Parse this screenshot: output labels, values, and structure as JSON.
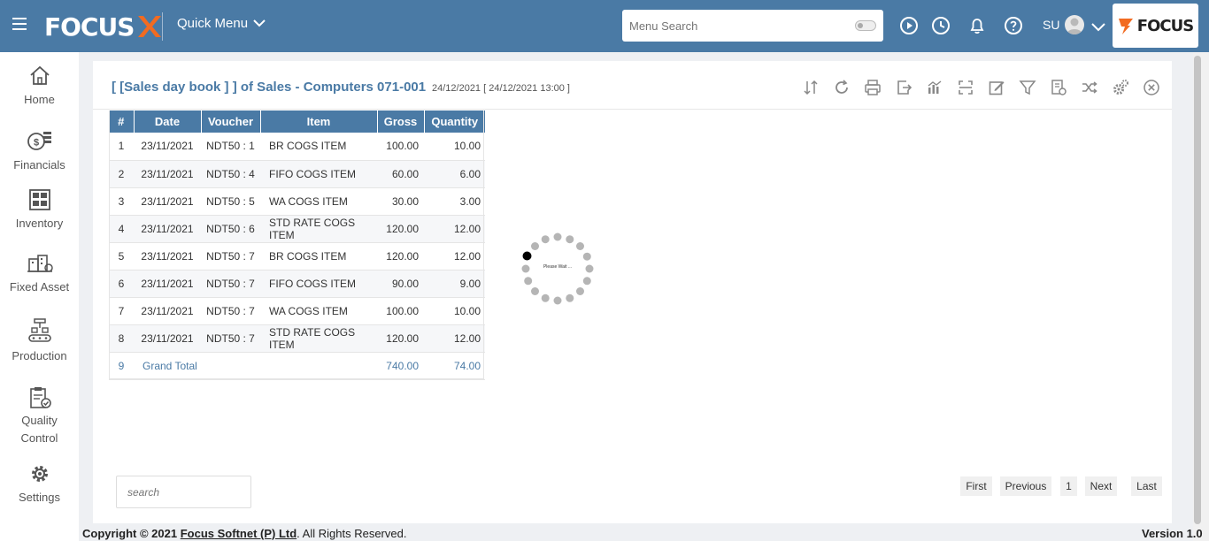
{
  "header": {
    "logo_text": "FOCUS",
    "quick_menu_label": "Quick Menu",
    "search_placeholder": "Menu Search",
    "user_initials": "SU",
    "brand_text": "FOCUS",
    "colors": {
      "bar": "#4a7aa5",
      "logo_x_orange": "#f26b21"
    }
  },
  "sidebar": {
    "items": [
      {
        "label": "Home",
        "icon": "home-icon"
      },
      {
        "label": "Financials",
        "icon": "coins-icon"
      },
      {
        "label": "Inventory",
        "icon": "warehouse-icon"
      },
      {
        "label": "Fixed Asset",
        "icon": "building-icon"
      },
      {
        "label": "Production",
        "icon": "conveyor-icon"
      },
      {
        "label": "Quality",
        "label2": "Control",
        "icon": "clipboard-check-icon"
      },
      {
        "label": "Settings",
        "icon": "gear-icon"
      }
    ]
  },
  "report": {
    "title": "[ [Sales day book ] ] of Sales - Computers 071-001",
    "subtitle": "24/12/2021 [ 24/12/2021 13:00 ]",
    "toolbar_icons": [
      "sort-icon",
      "refresh-icon",
      "print-icon",
      "export-icon",
      "chart-icon",
      "expand-icon",
      "edit-icon",
      "filter-icon",
      "report-settings-icon",
      "shuffle-icon",
      "settings-icon",
      "close-icon"
    ],
    "columns": [
      "#",
      "Date",
      "Voucher",
      "Item",
      "Gross",
      "Quantity"
    ],
    "rows": [
      {
        "n": "1",
        "date": "23/11/2021",
        "voucher": "NDT50 : 1",
        "item": "BR COGS ITEM",
        "gross": "100.00",
        "qty": "10.00"
      },
      {
        "n": "2",
        "date": "23/11/2021",
        "voucher": "NDT50 : 4",
        "item": "FIFO COGS ITEM",
        "gross": "60.00",
        "qty": "6.00"
      },
      {
        "n": "3",
        "date": "23/11/2021",
        "voucher": "NDT50 : 5",
        "item": "WA COGS ITEM",
        "gross": "30.00",
        "qty": "3.00"
      },
      {
        "n": "4",
        "date": "23/11/2021",
        "voucher": "NDT50 : 6",
        "item": "STD RATE COGS ITEM",
        "gross": "120.00",
        "qty": "12.00"
      },
      {
        "n": "5",
        "date": "23/11/2021",
        "voucher": "NDT50 : 7",
        "item": "BR COGS ITEM",
        "gross": "120.00",
        "qty": "12.00"
      },
      {
        "n": "6",
        "date": "23/11/2021",
        "voucher": "NDT50 : 7",
        "item": "FIFO COGS ITEM",
        "gross": "90.00",
        "qty": "9.00"
      },
      {
        "n": "7",
        "date": "23/11/2021",
        "voucher": "NDT50 : 7",
        "item": "WA COGS ITEM",
        "gross": "100.00",
        "qty": "10.00"
      },
      {
        "n": "8",
        "date": "23/11/2021",
        "voucher": "NDT50 : 7",
        "item": "STD RATE COGS ITEM",
        "gross": "120.00",
        "qty": "12.00"
      }
    ],
    "total": {
      "n": "9",
      "label": "Grand Total",
      "gross": "740.00",
      "qty": "74.00"
    },
    "loading_text": "Please Wait ..."
  },
  "search": {
    "placeholder": "search"
  },
  "pager": {
    "first": "First",
    "previous": "Previous",
    "page": "1",
    "next": "Next",
    "last": "Last"
  },
  "footer": {
    "copyright_prefix": "Copyright © 2021",
    "company": "Focus Softnet (P) Ltd",
    "suffix": ". All Rights Reserved.",
    "version": "Version 1.0"
  }
}
